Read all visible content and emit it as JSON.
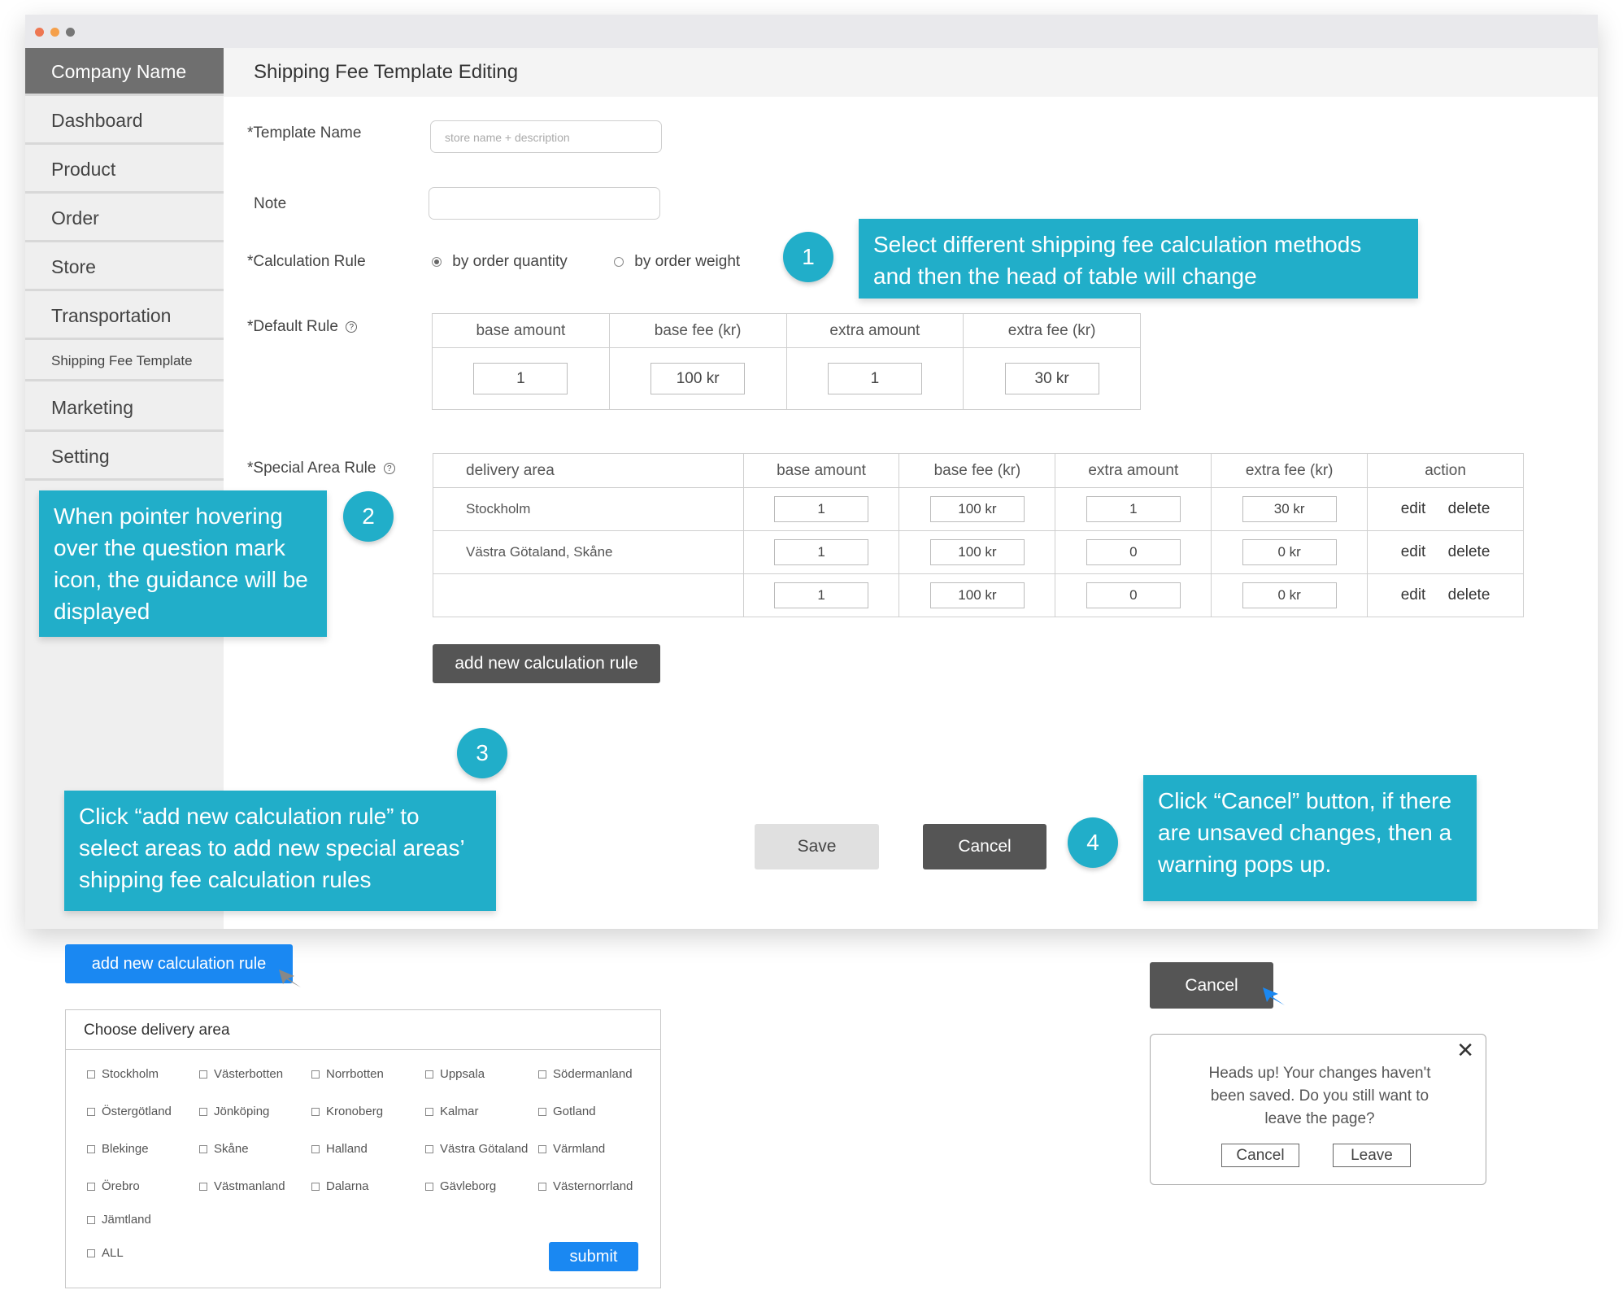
{
  "app": {
    "company": "Company Name",
    "page_title": "Shipping Fee Template Editing"
  },
  "colors": {
    "accent": "#21aec9",
    "primary_blue": "#1a88f2",
    "dark_button": "#555555"
  },
  "sidebar": {
    "items": [
      {
        "label": "Dashboard"
      },
      {
        "label": "Product"
      },
      {
        "label": "Order"
      },
      {
        "label": "Store"
      },
      {
        "label": "Transportation"
      },
      {
        "label": "Shipping Fee Template"
      },
      {
        "label": "Marketing"
      },
      {
        "label": "Setting"
      }
    ]
  },
  "form": {
    "template_name_label": "*Template Name",
    "template_name_placeholder": "store name + description",
    "note_label": "Note",
    "note_value": "",
    "calc_rule_label": "*Calculation Rule",
    "calc_options": [
      {
        "label": "by order quantity",
        "selected": true
      },
      {
        "label": "by order weight",
        "selected": false
      }
    ],
    "default_rule_label": "*Default Rule",
    "special_area_label": "*Special Area Rule",
    "help_icon": "question-circle-icon"
  },
  "default_table": {
    "headers": [
      "base amount",
      "base fee (kr)",
      "extra amount",
      "extra fee (kr)"
    ],
    "values": [
      "1",
      "100 kr",
      "1",
      "30 kr"
    ]
  },
  "special_table": {
    "headers": [
      "delivery area",
      "base amount",
      "base fee (kr)",
      "extra amount",
      "extra fee (kr)",
      "action"
    ],
    "rows": [
      {
        "area": "Stockholm",
        "base_amount": "1",
        "base_fee": "100 kr",
        "extra_amount": "1",
        "extra_fee": "30 kr"
      },
      {
        "area": "Västra Götaland, Skåne",
        "base_amount": "1",
        "base_fee": "100 kr",
        "extra_amount": "0",
        "extra_fee": "0 kr"
      },
      {
        "area": "",
        "base_amount": "1",
        "base_fee": "100 kr",
        "extra_amount": "0",
        "extra_fee": "0 kr"
      }
    ],
    "edit_label": "edit",
    "delete_label": "delete"
  },
  "buttons": {
    "add_rule": "add new calculation rule",
    "save": "Save",
    "cancel": "Cancel"
  },
  "annotations": [
    {
      "num": "1",
      "text": "Select different shipping fee calculation methods and then the head of table will change"
    },
    {
      "num": "2",
      "text": "When pointer hovering over the question mark icon, the guidance will be displayed"
    },
    {
      "num": "3",
      "text": "Click “add new calculation rule” to select areas to add new special areas’ shipping fee calculation rules"
    },
    {
      "num": "4",
      "text": "Click “Cancel” button, if there are unsaved changes, then a warning pops up."
    }
  ],
  "area_picker": {
    "button": "add new calculation rule",
    "title": "Choose delivery area",
    "areas": [
      "Stockholm",
      "Västerbotten",
      "Norrbotten",
      "Uppsala",
      "Södermanland",
      "Östergötland",
      "Jönköping",
      "Kronoberg",
      "Kalmar",
      "Gotland",
      "Blekinge",
      "Skåne",
      "Halland",
      "Västra Götaland",
      "Värmland",
      "Örebro",
      "Västmanland",
      "Dalarna",
      "Gävleborg",
      "Västernorrland",
      "Jämtland"
    ],
    "all_label": "ALL",
    "submit": "submit"
  },
  "warning": {
    "trigger": "Cancel",
    "message": "Heads up! Your changes haven't been saved. Do you still want to leave the page?",
    "cancel": "Cancel",
    "leave": "Leave",
    "close_icon": "close-icon"
  }
}
